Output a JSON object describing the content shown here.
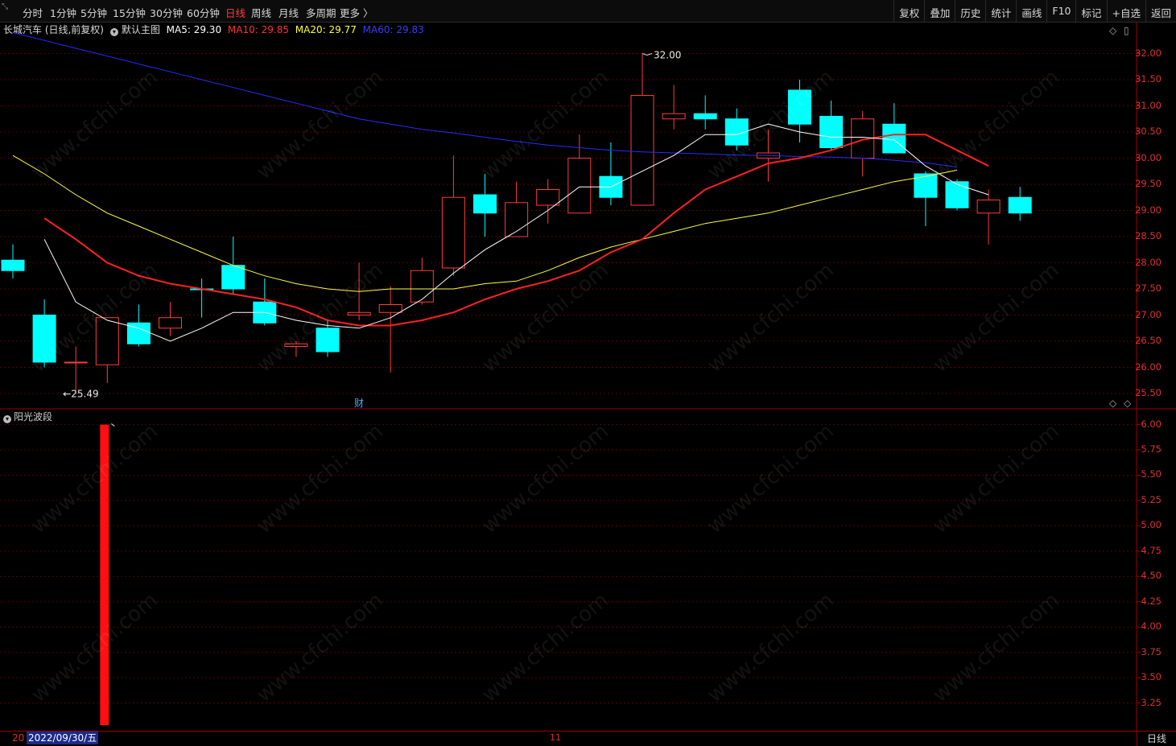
{
  "toolbar": {
    "corner_icon": "collapse-arrows-icon",
    "periods": [
      {
        "label": "分时",
        "active": false
      },
      {
        "label": "1分钟",
        "active": false
      },
      {
        "label": "5分钟",
        "active": false
      },
      {
        "label": "15分钟",
        "active": false
      },
      {
        "label": "30分钟",
        "active": false
      },
      {
        "label": "60分钟",
        "active": false
      },
      {
        "label": "日线",
        "active": true
      },
      {
        "label": "周线",
        "active": false
      },
      {
        "label": "月线",
        "active": false
      },
      {
        "label": "多周期",
        "active": false
      },
      {
        "label": "更多 〉",
        "active": false
      }
    ],
    "right_buttons": [
      "复权",
      "叠加",
      "历史",
      "统计",
      "画线",
      "F10",
      "标记",
      "+自选",
      "返回"
    ]
  },
  "main_chart": {
    "title": "长城汽车 (日线,前复权)",
    "template": "默认主图",
    "ma5": {
      "label": "MA5: 29.30",
      "color": "#ffffff"
    },
    "ma10": {
      "label": "MA10: 29.85",
      "color": "#ff2020"
    },
    "ma20": {
      "label": "MA20: 29.77",
      "color": "#ffff40"
    },
    "ma60": {
      "label": "MA60: 29.83",
      "color": "#2a2aff"
    },
    "high_label": "32.00",
    "low_label": "25.49",
    "finance_marker": "财",
    "y_ticks": [
      "32.00",
      "31.50",
      "31.00",
      "30.50",
      "30.00",
      "29.50",
      "29.00",
      "28.50",
      "28.00",
      "27.50",
      "27.00",
      "26.50",
      "26.00",
      "25.50"
    ],
    "y_min": 25.3,
    "y_max": 32.3
  },
  "chart_data": {
    "type": "candlestick",
    "candles": [
      {
        "o": 27.85,
        "c": 28.05,
        "h": 28.35,
        "l": 27.7,
        "up": false
      },
      {
        "o": 27.0,
        "c": 26.1,
        "h": 27.3,
        "l": 26.0,
        "up": false
      },
      {
        "o": 26.1,
        "c": 26.1,
        "h": 26.4,
        "l": 25.49,
        "up": true
      },
      {
        "o": 26.05,
        "c": 26.95,
        "h": 26.95,
        "l": 25.7,
        "up": true
      },
      {
        "o": 26.85,
        "c": 26.45,
        "h": 27.2,
        "l": 26.4,
        "up": false
      },
      {
        "o": 26.75,
        "c": 26.95,
        "h": 27.25,
        "l": 26.6,
        "up": true
      },
      {
        "o": 27.5,
        "c": 27.5,
        "h": 27.7,
        "l": 26.95,
        "up": false
      },
      {
        "o": 27.95,
        "c": 27.5,
        "h": 28.5,
        "l": 27.4,
        "up": false
      },
      {
        "o": 27.25,
        "c": 26.85,
        "h": 27.7,
        "l": 26.8,
        "up": false
      },
      {
        "o": 26.4,
        "c": 26.45,
        "h": 26.5,
        "l": 26.2,
        "up": true
      },
      {
        "o": 26.75,
        "c": 26.3,
        "h": 26.9,
        "l": 26.2,
        "up": false
      },
      {
        "o": 27.0,
        "c": 27.05,
        "h": 28.0,
        "l": 26.9,
        "up": true
      },
      {
        "o": 27.05,
        "c": 27.2,
        "h": 27.55,
        "l": 25.9,
        "up": true
      },
      {
        "o": 27.25,
        "c": 27.85,
        "h": 28.1,
        "l": 27.2,
        "up": true
      },
      {
        "o": 27.9,
        "c": 29.25,
        "h": 30.05,
        "l": 27.75,
        "up": true
      },
      {
        "o": 29.3,
        "c": 28.95,
        "h": 29.7,
        "l": 28.5,
        "up": false
      },
      {
        "o": 28.5,
        "c": 29.15,
        "h": 29.55,
        "l": 28.5,
        "up": true
      },
      {
        "o": 29.1,
        "c": 29.4,
        "h": 29.6,
        "l": 28.75,
        "up": true
      },
      {
        "o": 28.95,
        "c": 30.0,
        "h": 30.45,
        "l": 28.95,
        "up": true
      },
      {
        "o": 29.65,
        "c": 29.25,
        "h": 30.3,
        "l": 29.1,
        "up": false
      },
      {
        "o": 29.1,
        "c": 31.2,
        "h": 32.0,
        "l": 29.1,
        "up": true
      },
      {
        "o": 30.85,
        "c": 30.75,
        "h": 31.4,
        "l": 30.55,
        "up": true
      },
      {
        "o": 30.85,
        "c": 30.75,
        "h": 31.2,
        "l": 30.55,
        "up": false
      },
      {
        "o": 30.75,
        "c": 30.25,
        "h": 30.95,
        "l": 30.15,
        "up": false
      },
      {
        "o": 30.0,
        "c": 30.1,
        "h": 30.55,
        "l": 29.55,
        "up": true
      },
      {
        "o": 31.3,
        "c": 30.65,
        "h": 31.5,
        "l": 30.3,
        "up": false
      },
      {
        "o": 30.8,
        "c": 30.2,
        "h": 31.1,
        "l": 30.15,
        "up": false
      },
      {
        "o": 30.0,
        "c": 30.75,
        "h": 30.9,
        "l": 29.65,
        "up": true
      },
      {
        "o": 30.65,
        "c": 30.1,
        "h": 31.05,
        "l": 30.1,
        "up": false
      },
      {
        "o": 29.7,
        "c": 29.25,
        "h": 29.75,
        "l": 28.7,
        "up": false
      },
      {
        "o": 29.55,
        "c": 29.05,
        "h": 29.6,
        "l": 29.0,
        "up": false
      },
      {
        "o": 28.95,
        "c": 29.2,
        "h": 29.4,
        "l": 28.35,
        "up": true
      },
      {
        "o": 29.25,
        "c": 28.95,
        "h": 29.45,
        "l": 28.8,
        "up": false
      }
    ],
    "ma5": [
      28.45,
      27.25,
      26.9,
      26.75,
      26.5,
      26.75,
      27.05,
      27.05,
      26.9,
      26.8,
      26.75,
      26.95,
      27.3,
      27.8,
      28.25,
      28.6,
      29.0,
      29.45,
      29.45,
      29.75,
      30.05,
      30.45,
      30.45,
      30.65,
      30.5,
      30.4,
      30.4,
      30.35,
      29.85,
      29.5,
      29.3
    ],
    "ma10": [
      28.85,
      28.45,
      28.0,
      27.75,
      27.6,
      27.5,
      27.4,
      27.3,
      27.15,
      26.9,
      26.8,
      26.8,
      26.9,
      27.05,
      27.3,
      27.5,
      27.65,
      27.85,
      28.2,
      28.45,
      28.95,
      29.4,
      29.65,
      29.9,
      30.0,
      30.15,
      30.35,
      30.45,
      30.45,
      30.15,
      29.85
    ],
    "ma20": [
      30.05,
      29.7,
      29.3,
      28.95,
      28.7,
      28.45,
      28.2,
      27.95,
      27.75,
      27.6,
      27.5,
      27.45,
      27.5,
      27.5,
      27.5,
      27.6,
      27.65,
      27.85,
      28.1,
      28.3,
      28.45,
      28.6,
      28.75,
      28.85,
      28.95,
      29.1,
      29.25,
      29.4,
      29.55,
      29.65,
      29.77
    ],
    "ma60": [
      32.4,
      32.25,
      32.1,
      31.95,
      31.8,
      31.65,
      31.5,
      31.35,
      31.2,
      31.05,
      30.9,
      30.75,
      30.65,
      30.55,
      30.48,
      30.4,
      30.32,
      30.25,
      30.2,
      30.15,
      30.12,
      30.1,
      30.08,
      30.06,
      30.05,
      30.03,
      30.02,
      30.0,
      29.96,
      29.91,
      29.83
    ]
  },
  "sub_chart": {
    "title": "阳光波段",
    "bar_value": 6.0,
    "y_ticks": [
      "6.00",
      "5.75",
      "5.50",
      "5.25",
      "5.00",
      "4.75",
      "4.50",
      "4.25",
      "4.00",
      "3.75",
      "3.50",
      "3.25"
    ],
    "y_min": 3.0,
    "y_max": 6.1
  },
  "footer": {
    "date_prefix": "20",
    "date": "2022/09/30/五",
    "month_tick": "11",
    "period": "日线"
  },
  "watermark": "www.cfchi.com"
}
